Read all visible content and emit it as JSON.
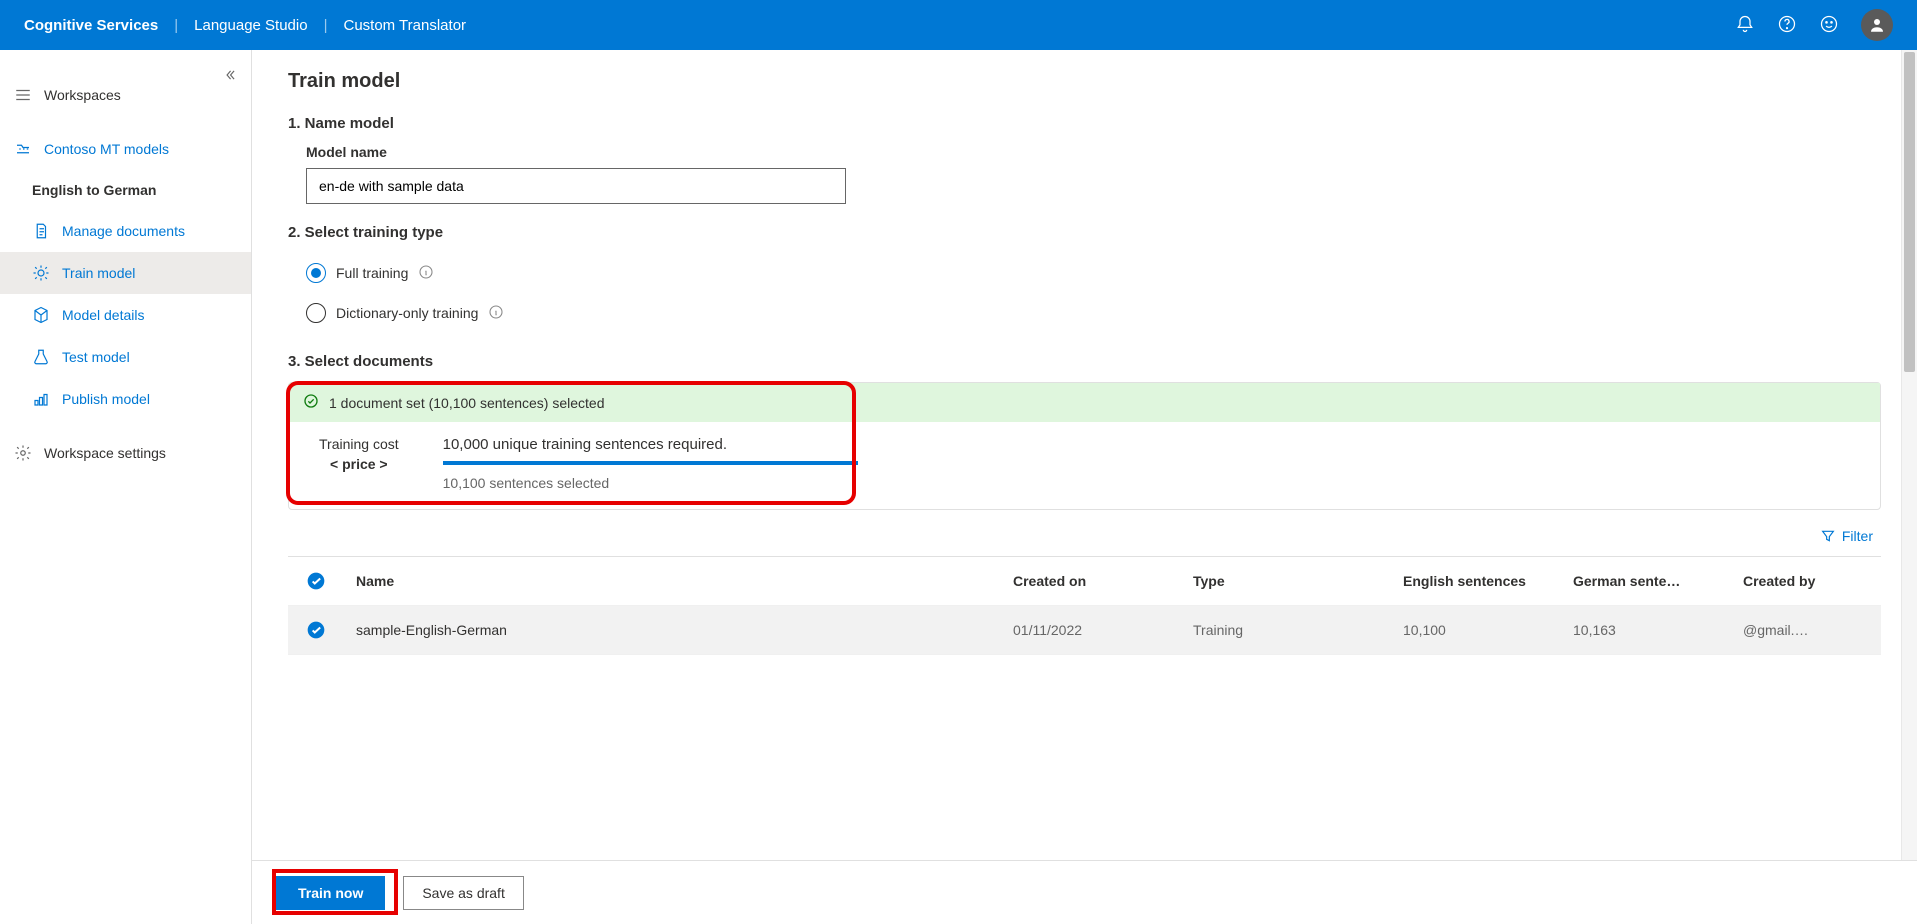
{
  "header": {
    "breadcrumb": [
      "Cognitive Services",
      "Language Studio",
      "Custom Translator"
    ]
  },
  "sidebar": {
    "workspaces": "Workspaces",
    "project_group": "Contoso MT models",
    "project_name": "English to German",
    "items": [
      {
        "label": "Manage documents"
      },
      {
        "label": "Train model"
      },
      {
        "label": "Model details"
      },
      {
        "label": "Test model"
      },
      {
        "label": "Publish model"
      }
    ],
    "settings": "Workspace settings"
  },
  "main": {
    "title": "Train model",
    "step1": {
      "heading": "1. Name model",
      "field_label": "Model name",
      "value": "en-de with sample data"
    },
    "step2": {
      "heading": "2. Select training type",
      "options": [
        {
          "label": "Full training",
          "checked": true
        },
        {
          "label": "Dictionary-only training",
          "checked": false
        }
      ]
    },
    "step3": {
      "heading": "3. Select documents",
      "banner": "1 document set (10,100 sentences) selected",
      "cost_label": "Training cost",
      "cost_value": "< price >",
      "required": "10,000 unique training sentences required.",
      "selected": "10,100 sentences selected",
      "filter": "Filter",
      "table": {
        "columns": [
          "Name",
          "Created on",
          "Type",
          "English sentences",
          "German sente…",
          "Created by"
        ],
        "rows": [
          {
            "name": "sample-English-German",
            "created": "01/11/2022",
            "type": "Training",
            "en": "10,100",
            "de": "10,163",
            "by": "@gmail.…"
          }
        ]
      }
    },
    "buttons": {
      "train": "Train now",
      "draft": "Save as draft"
    }
  }
}
